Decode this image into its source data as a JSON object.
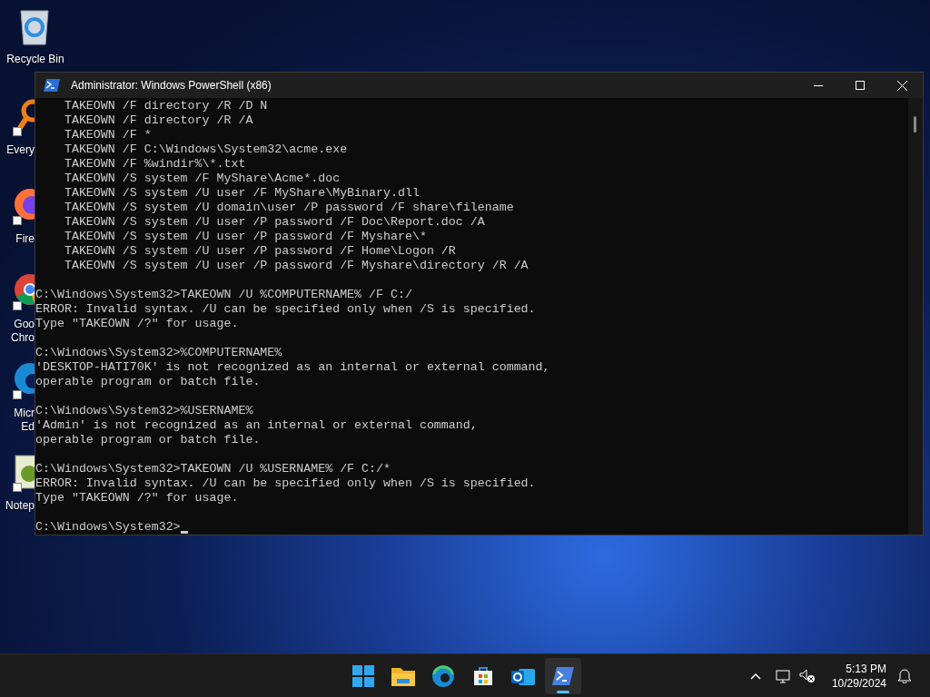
{
  "desktop_icons": [
    {
      "kind": "recycle",
      "label": [
        "Recycle Bin"
      ]
    },
    {
      "kind": "everything",
      "label": [
        "Every"
      ]
    },
    {
      "kind": "firefox",
      "label": [
        "Fire"
      ]
    },
    {
      "kind": "chrome",
      "label": [
        "Goo",
        "Chro"
      ]
    },
    {
      "kind": "edge",
      "label": [
        "Micr",
        "Ed"
      ]
    },
    {
      "kind": "notepad",
      "label": [
        "Notep"
      ]
    }
  ],
  "window": {
    "title": "Administrator: Windows PowerShell (x86)",
    "blocks": [
      [
        "    TAKEOWN /F directory /R /D N",
        "    TAKEOWN /F directory /R /A",
        "    TAKEOWN /F *",
        "    TAKEOWN /F C:\\Windows\\System32\\acme.exe",
        "    TAKEOWN /F %windir%\\*.txt",
        "    TAKEOWN /S system /F MyShare\\Acme*.doc",
        "    TAKEOWN /S system /U user /F MyShare\\MyBinary.dll",
        "    TAKEOWN /S system /U domain\\user /P password /F share\\filename",
        "    TAKEOWN /S system /U user /P password /F Doc\\Report.doc /A",
        "    TAKEOWN /S system /U user /P password /F Myshare\\*",
        "    TAKEOWN /S system /U user /P password /F Home\\Logon /R",
        "    TAKEOWN /S system /U user /P password /F Myshare\\directory /R /A"
      ],
      [
        "C:\\Windows\\System32>TAKEOWN /U %COMPUTERNAME% /F C:/",
        "ERROR: Invalid syntax. /U can be specified only when /S is specified.",
        "Type \"TAKEOWN /?\" for usage."
      ],
      [
        "C:\\Windows\\System32>%COMPUTERNAME%",
        "'DESKTOP-HATI70K' is not recognized as an internal or external command,",
        "operable program or batch file."
      ],
      [
        "C:\\Windows\\System32>%USERNAME%",
        "'Admin' is not recognized as an internal or external command,",
        "operable program or batch file."
      ],
      [
        "C:\\Windows\\System32>TAKEOWN /U %USERNAME% /F C:/*",
        "ERROR: Invalid syntax. /U can be specified only when /S is specified.",
        "Type \"TAKEOWN /?\" for usage."
      ]
    ],
    "prompt": "C:\\Windows\\System32>"
  },
  "taskbar": {
    "apps": [
      {
        "kind": "start",
        "selected": false
      },
      {
        "kind": "explorer",
        "selected": false
      },
      {
        "kind": "edge",
        "selected": false
      },
      {
        "kind": "store",
        "selected": false
      },
      {
        "kind": "outlook",
        "selected": false
      },
      {
        "kind": "powershell",
        "selected": true
      }
    ],
    "time": "5:13 PM",
    "date": "10/29/2024"
  }
}
